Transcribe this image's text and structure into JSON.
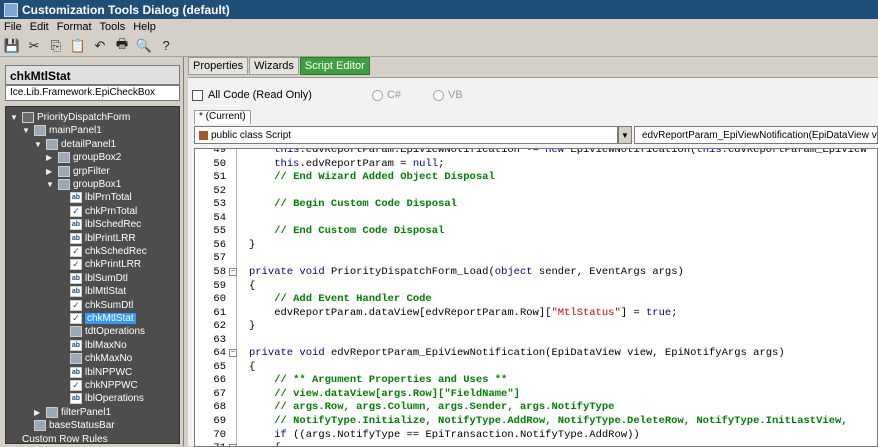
{
  "window": {
    "title": "Customization Tools Dialog (default)"
  },
  "menu": [
    "File",
    "Edit",
    "Format",
    "Tools",
    "Help"
  ],
  "toolbar": {
    "icons": [
      "save-icon",
      "cut-icon",
      "copy-icon",
      "paste-icon",
      "undo-icon",
      "print-icon",
      "print-preview-icon",
      "help-icon"
    ],
    "glyphs": [
      "💾",
      "✂",
      "⎘",
      "📋",
      "↶",
      "🖶",
      "🔍",
      "?"
    ]
  },
  "left_panel": {
    "control_name": "chkMtlStat",
    "control_type": "Ice.Lib.Framework.EpiCheckBox",
    "tree": [
      {
        "label": "PriorityDispatchForm",
        "indent": 0,
        "expander": "▼",
        "icon": "form"
      },
      {
        "label": "mainPanel1",
        "indent": 1,
        "expander": "▼",
        "icon": "grp"
      },
      {
        "label": "detailPanel1",
        "indent": 2,
        "expander": "▼",
        "icon": "grp"
      },
      {
        "label": "groupBox2",
        "indent": 3,
        "expander": "▶",
        "icon": "grp"
      },
      {
        "label": "grpFilter",
        "indent": 3,
        "expander": "▶",
        "icon": "grp"
      },
      {
        "label": "groupBox1",
        "indent": 3,
        "expander": "▼",
        "icon": "grp"
      },
      {
        "label": "lblPrnTotal",
        "indent": 4,
        "expander": "",
        "icon": "lbl"
      },
      {
        "label": "chkPrnTotal",
        "indent": 4,
        "expander": "",
        "icon": "chk"
      },
      {
        "label": "lblSchedRec",
        "indent": 4,
        "expander": "",
        "icon": "lbl"
      },
      {
        "label": "lblPrintLRR",
        "indent": 4,
        "expander": "",
        "icon": "lbl"
      },
      {
        "label": "chkSchedRec",
        "indent": 4,
        "expander": "",
        "icon": "chk"
      },
      {
        "label": "chkPrintLRR",
        "indent": 4,
        "expander": "",
        "icon": "chk"
      },
      {
        "label": "lblSumDtl",
        "indent": 4,
        "expander": "",
        "icon": "lbl"
      },
      {
        "label": "lblMtlStat",
        "indent": 4,
        "expander": "",
        "icon": "lbl"
      },
      {
        "label": "chkSumDtl",
        "indent": 4,
        "expander": "",
        "icon": "chk"
      },
      {
        "label": "chkMtlStat",
        "indent": 4,
        "expander": "",
        "icon": "chk",
        "selected": true
      },
      {
        "label": "tdtOperations",
        "indent": 4,
        "expander": "",
        "icon": "grp"
      },
      {
        "label": "lblMaxNo",
        "indent": 4,
        "expander": "",
        "icon": "lbl"
      },
      {
        "label": "chkMaxNo",
        "indent": 4,
        "expander": "",
        "icon": "grp"
      },
      {
        "label": "lblNPPWC",
        "indent": 4,
        "expander": "",
        "icon": "lbl"
      },
      {
        "label": "chkNPPWC",
        "indent": 4,
        "expander": "",
        "icon": "chk"
      },
      {
        "label": "lblOperations",
        "indent": 4,
        "expander": "",
        "icon": "lbl"
      },
      {
        "label": "filterPanel1",
        "indent": 2,
        "expander": "▶",
        "icon": "grp"
      },
      {
        "label": "baseStatusBar",
        "indent": 1,
        "expander": "",
        "icon": "grp"
      },
      {
        "label": "Custom Row Rules",
        "indent": 0,
        "expander": "",
        "icon": "none"
      }
    ]
  },
  "tabs": [
    {
      "label": "Properties",
      "active": false
    },
    {
      "label": "Wizards",
      "active": false
    },
    {
      "label": "Script Editor",
      "active": true
    }
  ],
  "script_editor": {
    "all_code_label": "All Code (Read Only)",
    "lang_csharp": "C#",
    "lang_vb": "VB",
    "current_tab": "* (Current)",
    "class_dropdown": "public class Script",
    "method_dropdown": "edvReportParam_EpiViewNotification(EpiDataView view, E",
    "lines": [
      {
        "n": "49",
        "fold": "",
        "text": "    this.edvReportParam.EpiViewNotification -= new EpiViewNotification(this.edvReportParam_EpiView",
        "cls": ""
      },
      {
        "n": "50",
        "fold": "",
        "text": "    this.edvReportParam = null;",
        "cls": ""
      },
      {
        "n": "51",
        "fold": "",
        "text": "    // End Wizard Added Object Disposal",
        "cls": "cm"
      },
      {
        "n": "52",
        "fold": "",
        "text": "",
        "cls": ""
      },
      {
        "n": "53",
        "fold": "",
        "text": "    // Begin Custom Code Disposal",
        "cls": "cm"
      },
      {
        "n": "54",
        "fold": "",
        "text": "",
        "cls": ""
      },
      {
        "n": "55",
        "fold": "",
        "text": "    // End Custom Code Disposal",
        "cls": "cm"
      },
      {
        "n": "56",
        "fold": "",
        "text": "}",
        "cls": ""
      },
      {
        "n": "57",
        "fold": "",
        "text": "",
        "cls": ""
      },
      {
        "n": "58",
        "fold": "−",
        "text": "private void PriorityDispatchForm_Load(object sender, EventArgs args)",
        "cls": ""
      },
      {
        "n": "59",
        "fold": "",
        "text": "{",
        "cls": ""
      },
      {
        "n": "60",
        "fold": "",
        "text": "    // Add Event Handler Code",
        "cls": "cm"
      },
      {
        "n": "61",
        "fold": "",
        "text": "    edvReportParam.dataView[edvReportParam.Row][\"MtlStatus\"] = true;",
        "cls": ""
      },
      {
        "n": "62",
        "fold": "",
        "text": "}",
        "cls": ""
      },
      {
        "n": "63",
        "fold": "",
        "text": "",
        "cls": ""
      },
      {
        "n": "64",
        "fold": "−",
        "text": "private void edvReportParam_EpiViewNotification(EpiDataView view, EpiNotifyArgs args)",
        "cls": ""
      },
      {
        "n": "65",
        "fold": "",
        "text": "{",
        "cls": ""
      },
      {
        "n": "66",
        "fold": "",
        "text": "    // ** Argument Properties and Uses **",
        "cls": "cm"
      },
      {
        "n": "67",
        "fold": "",
        "text": "    // view.dataView[args.Row][\"FieldName\"]",
        "cls": "cm"
      },
      {
        "n": "68",
        "fold": "",
        "text": "    // args.Row, args.Column, args.Sender, args.NotifyType",
        "cls": "cm"
      },
      {
        "n": "69",
        "fold": "",
        "text": "    // NotifyType.Initialize, NotifyType.AddRow, NotifyType.DeleteRow, NotifyType.InitLastView,",
        "cls": "cm"
      },
      {
        "n": "70",
        "fold": "",
        "text": "    if ((args.NotifyType == EpiTransaction.NotifyType.AddRow))",
        "cls": ""
      },
      {
        "n": "71",
        "fold": "−",
        "text": "    {",
        "cls": ""
      }
    ]
  }
}
